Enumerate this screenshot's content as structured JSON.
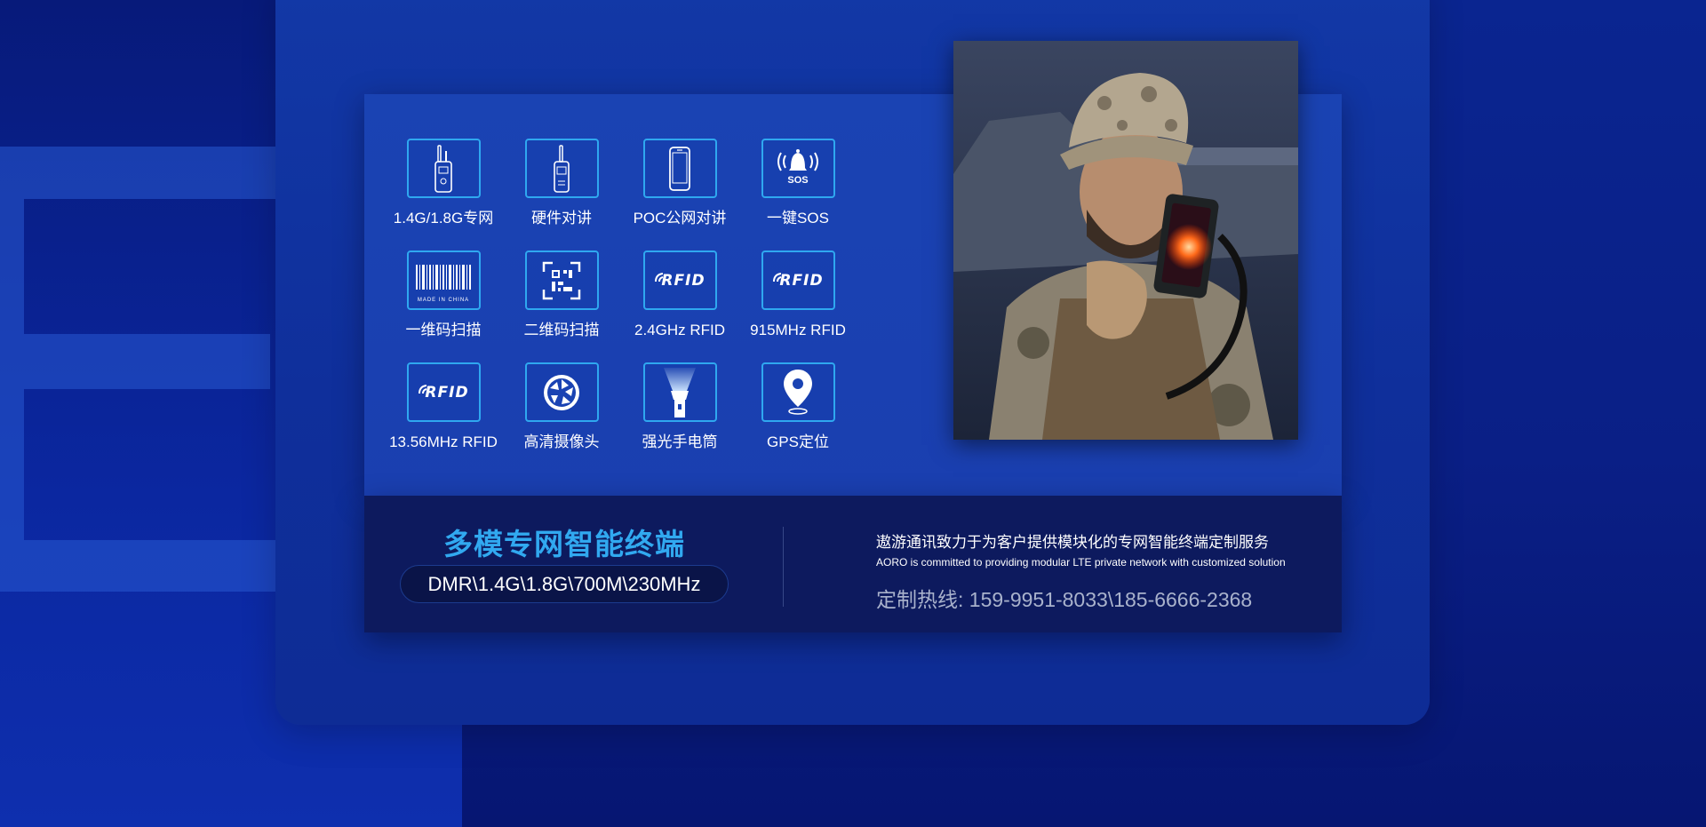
{
  "features": [
    {
      "label": "1.4G/1.8G专网",
      "icon": "walkie-talkie-icon"
    },
    {
      "label": "硬件对讲",
      "icon": "walkie-talkie-icon"
    },
    {
      "label": "POC公网对讲",
      "icon": "smartphone-icon"
    },
    {
      "label": "一键SOS",
      "icon": "sos-bell-icon",
      "icon_text": "SOS"
    },
    {
      "label": "一维码扫描",
      "icon": "barcode-icon",
      "icon_text": "MADE IN CHINA"
    },
    {
      "label": "二维码扫描",
      "icon": "qr-code-icon"
    },
    {
      "label": "2.4GHz RFID",
      "icon": "rfid-icon",
      "icon_text": "RFID"
    },
    {
      "label": "915MHz RFID",
      "icon": "rfid-icon",
      "icon_text": "RFID"
    },
    {
      "label": "13.56MHz RFID",
      "icon": "rfid-icon",
      "icon_text": "RFID"
    },
    {
      "label": "高清摄像头",
      "icon": "camera-aperture-icon"
    },
    {
      "label": "强光手电筒",
      "icon": "flashlight-icon"
    },
    {
      "label": "GPS定位",
      "icon": "location-pin-icon"
    }
  ],
  "product": {
    "title": "多模专网智能终端",
    "bands": "DMR\\1.4G\\1.8G\\700M\\230MHz"
  },
  "company": {
    "slogan_cn": "遨游通讯致力于为客户提供模块化的专网智能终端定制服务",
    "slogan_en": "AORO is committed to providing modular LTE private network with customized solution",
    "hotline": "定制热线: 159-9951-8033\\185-6666-2368"
  },
  "colors": {
    "accent": "#2fa8f0",
    "title": "#31a9f0",
    "panel": "#1a43b3",
    "bottom_panel": "#0d1a5e"
  }
}
